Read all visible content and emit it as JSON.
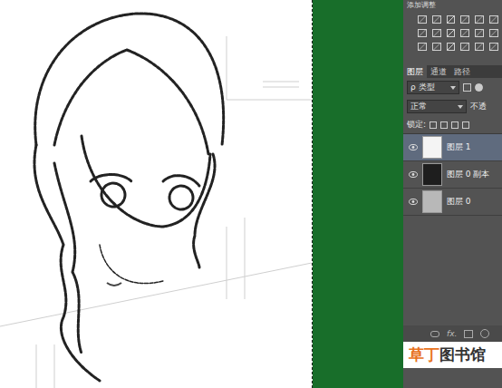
{
  "adjustments": {
    "title": "添加调整"
  },
  "layers_panel": {
    "tabs": [
      {
        "label": "图层",
        "selected": true
      },
      {
        "label": "通道",
        "selected": false
      },
      {
        "label": "路径",
        "selected": false
      }
    ],
    "filter": {
      "label": "ρ 类型"
    },
    "blend_mode": "正常",
    "opacity_label": "不透",
    "lock_label": "锁定:",
    "layers": [
      {
        "name": "图层 1",
        "visible": true,
        "selected": true,
        "color": "#f4f4f4"
      },
      {
        "name": "图层 0 副本",
        "visible": true,
        "selected": false,
        "color": "#1e1e1e"
      },
      {
        "name": "图层 0",
        "visible": true,
        "selected": false,
        "color": "#b8b8b8"
      }
    ],
    "fx_label": "fx."
  },
  "watermark": {
    "parts": [
      {
        "text": "草丁",
        "color": "#e8721c"
      },
      {
        "text": "图书馆",
        "color": "#333333"
      }
    ]
  }
}
